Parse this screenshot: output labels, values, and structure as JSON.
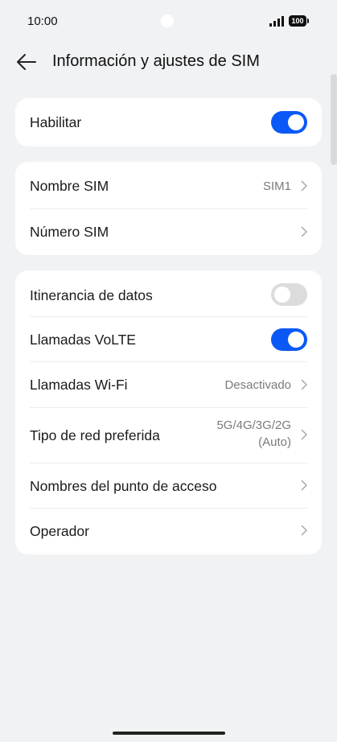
{
  "status": {
    "time": "10:00",
    "battery": "100"
  },
  "header": {
    "title": "Información y ajustes de SIM"
  },
  "card1": {
    "enable_label": "Habilitar",
    "enable_on": true
  },
  "card2": {
    "name_label": "Nombre SIM",
    "name_value": "SIM1",
    "number_label": "Número SIM"
  },
  "card3": {
    "roaming_label": "Itinerancia de datos",
    "roaming_on": false,
    "volte_label": "Llamadas VoLTE",
    "volte_on": true,
    "wifi_label": "Llamadas Wi-Fi",
    "wifi_value": "Desactivado",
    "network_label": "Tipo de red preferida",
    "network_value_line1": "5G/4G/3G/2G",
    "network_value_line2": "(Auto)",
    "apn_label": "Nombres del punto de acceso",
    "operator_label": "Operador"
  },
  "colors": {
    "accent": "#0a59f7",
    "background": "#f1f2f4",
    "card": "#ffffff",
    "toggle_off": "#dcdcdc"
  },
  "icons": [
    "back-arrow-icon",
    "signal-icon",
    "battery-icon",
    "chevron-right-icon"
  ]
}
